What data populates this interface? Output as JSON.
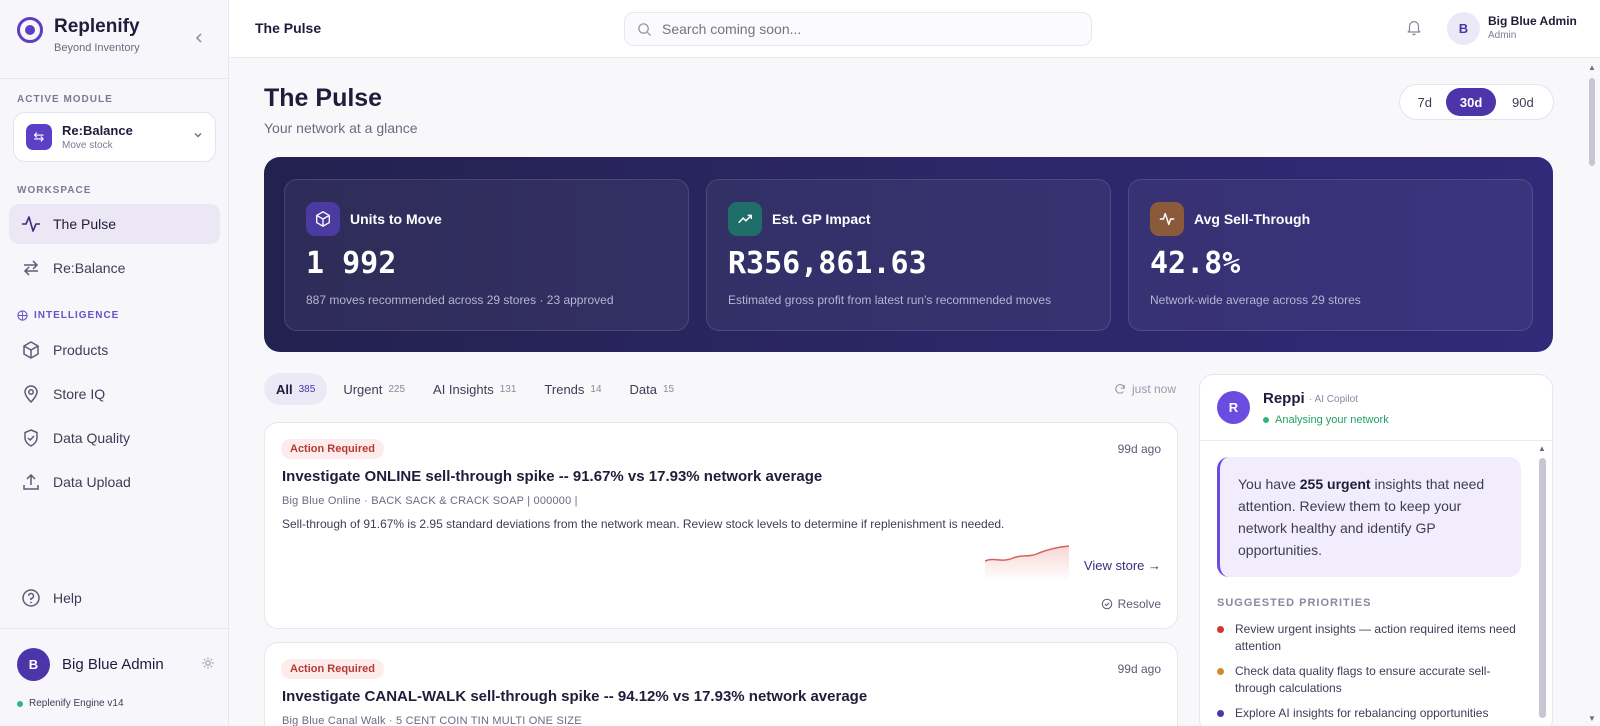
{
  "brand": {
    "name": "Replenify",
    "tagline": "Beyond Inventory"
  },
  "sidebar": {
    "active_module_label": "ACTIVE MODULE",
    "module": {
      "name": "Re:Balance",
      "subtitle": "Move stock"
    },
    "workspace_label": "WORKSPACE",
    "workspace_items": [
      {
        "label": "The Pulse",
        "icon": "pulse-icon",
        "active": true
      },
      {
        "label": "Re:Balance",
        "icon": "arrows-swap-icon",
        "active": false
      }
    ],
    "intelligence_label": "INTELLIGENCE",
    "intelligence_items": [
      {
        "label": "Products",
        "icon": "box-icon"
      },
      {
        "label": "Store IQ",
        "icon": "location-pin-icon"
      },
      {
        "label": "Data Quality",
        "icon": "shield-check-icon"
      },
      {
        "label": "Data Upload",
        "icon": "upload-icon"
      }
    ],
    "help_label": "Help",
    "user": {
      "initial": "B",
      "name": "Big Blue Admin"
    },
    "engine": "Replenify Engine v14"
  },
  "topbar": {
    "title": "The Pulse",
    "search_placeholder": "Search coming soon...",
    "user": {
      "initial": "B",
      "name": "Big Blue Admin",
      "role": "Admin"
    }
  },
  "page": {
    "title": "The Pulse",
    "subtitle": "Your network at a glance",
    "ranges": [
      {
        "label": "7d",
        "active": false
      },
      {
        "label": "30d",
        "active": true
      },
      {
        "label": "90d",
        "active": false
      }
    ]
  },
  "kpis": [
    {
      "title": "Units to Move",
      "value": "1 992",
      "desc": "887 moves recommended across 29 stores · 23 approved",
      "icon": "cube-icon",
      "icon_bg": "#4b3aa0"
    },
    {
      "title": "Est. GP Impact",
      "value": "R356,861.63",
      "desc": "Estimated gross profit from latest run's recommended moves",
      "icon": "trend-up-icon",
      "icon_bg": "#1f6e6a"
    },
    {
      "title": "Avg Sell-Through",
      "value": "42.8%",
      "desc": "Network-wide average across 29 stores",
      "icon": "activity-icon",
      "icon_bg": "#8a5a3a"
    }
  ],
  "tabs": [
    {
      "label": "All",
      "count": "385",
      "active": true
    },
    {
      "label": "Urgent",
      "count": "225",
      "active": false
    },
    {
      "label": "AI Insights",
      "count": "131",
      "active": false
    },
    {
      "label": "Trends",
      "count": "14",
      "active": false
    },
    {
      "label": "Data",
      "count": "15",
      "active": false
    }
  ],
  "refresh_label": "just now",
  "insights": [
    {
      "badge": "Action Required",
      "time": "99d ago",
      "title": "Investigate ONLINE sell-through spike -- 91.67% vs 17.93% network average",
      "meta": "Big Blue Online · BACK SACK & CRACK SOAP | 000000 |",
      "body": "Sell-through of 91.67% is 2.95 standard deviations from the network mean. Review stock levels to determine if replenishment is needed.",
      "view_label": "View store →",
      "resolve_label": "Resolve"
    },
    {
      "badge": "Action Required",
      "time": "99d ago",
      "title": "Investigate CANAL-WALK sell-through spike -- 94.12% vs 17.93% network average",
      "meta": "Big Blue Canal Walk · 5 CENT COIN TIN MULTI ONE SIZE"
    }
  ],
  "copilot": {
    "initial": "R",
    "name": "Reppi",
    "role": "· AI Copilot",
    "status": "Analysing your network",
    "msg_pre": "You have ",
    "msg_bold": "255 urgent",
    "msg_post": " insights that need attention. Review them to keep your network healthy and identify GP opportunities.",
    "section": "SUGGESTED PRIORITIES",
    "priorities": [
      {
        "text": "Review urgent insights — action required items need attention",
        "color": "#d6342c"
      },
      {
        "text": "Check data quality flags to ensure accurate sell-through calculations",
        "color": "#d4892a"
      },
      {
        "text": "Explore AI insights for rebalancing opportunities",
        "color": "#4b35a8"
      }
    ]
  },
  "colors": {
    "accent": "#4b35a8",
    "hero_bg": "#2a2562",
    "urgent": "#b53a32",
    "online": "#23a06a"
  }
}
